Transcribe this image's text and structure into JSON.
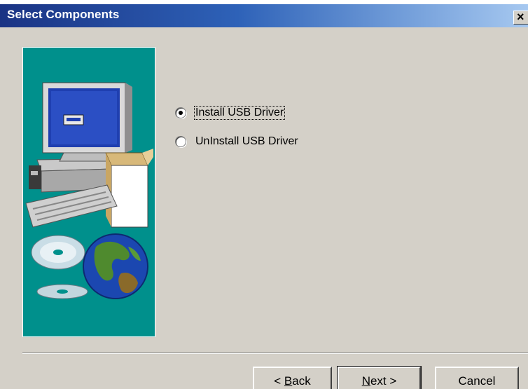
{
  "window": {
    "title": "Select Components",
    "close_glyph": "×"
  },
  "options": [
    {
      "label": "Install USB Driver",
      "checked": true
    },
    {
      "label": "UnInstall USB Driver",
      "checked": false
    }
  ],
  "buttons": {
    "back": {
      "prefix": "< ",
      "accel": "B",
      "rest": "ack"
    },
    "next": {
      "accel": "N",
      "rest": "ext >"
    },
    "cancel": {
      "label": "Cancel"
    }
  },
  "art": {
    "icons": [
      "computer-monitor-icon",
      "computer-case-icon",
      "keyboard-icon",
      "software-box-icon",
      "cd-disc-icon",
      "globe-icon"
    ]
  },
  "colors": {
    "titlebar_start": "#1a3384",
    "titlebar_end": "#a6c8f0",
    "dialog_bg": "#d4d0c8",
    "art_bg": "#00908c"
  }
}
